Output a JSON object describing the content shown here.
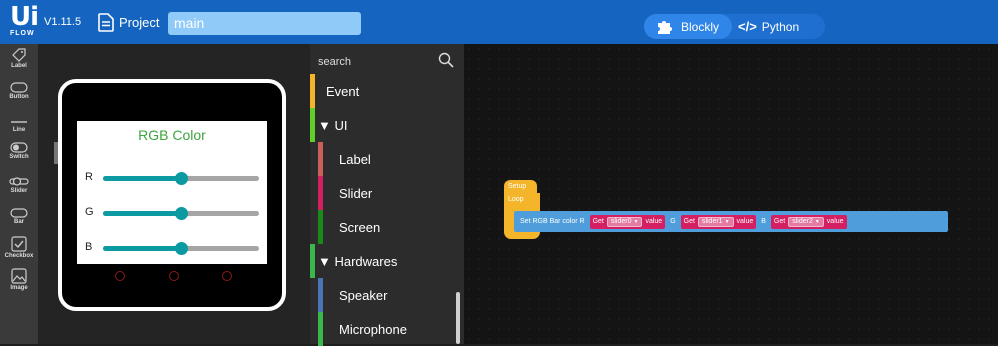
{
  "app": {
    "logo_main": "Ui",
    "logo_sub": "FLOW",
    "version": "V1.11.5",
    "project_label": "Project",
    "filename_value": "main"
  },
  "mode_toggle": {
    "blockly_label": "Blockly",
    "python_code_glyph": "</>",
    "python_label": "Python",
    "active": "Blockly"
  },
  "toolbox": {
    "items": [
      {
        "label": "Label",
        "icon": "tag-icon"
      },
      {
        "label": "Button",
        "icon": "button-icon"
      },
      {
        "label": "Line",
        "icon": "line-icon"
      },
      {
        "label": "Switch",
        "icon": "switch-icon"
      },
      {
        "label": "Slider",
        "icon": "slider-icon"
      },
      {
        "label": "Bar",
        "icon": "bar-icon"
      },
      {
        "label": "Checkbox",
        "icon": "checkbox-icon"
      },
      {
        "label": "Image",
        "icon": "image-icon"
      }
    ]
  },
  "device_screen": {
    "title": "RGB Color",
    "sliders": [
      {
        "label": "R",
        "value": 50
      },
      {
        "label": "G",
        "value": 50
      },
      {
        "label": "B",
        "value": 50
      }
    ],
    "colors": {
      "title": "#3ea43e",
      "slider": "#0b9aa2",
      "track": "#a5a5a5"
    }
  },
  "palette": {
    "search_placeholder": "search",
    "categories": [
      {
        "label": "Event",
        "color": "#f5b52a",
        "indent": false
      },
      {
        "label": "▼ UI",
        "color": "#5fcf2a",
        "indent": false
      },
      {
        "label": "Label",
        "color": "#c9605a",
        "indent": true
      },
      {
        "label": "Slider",
        "color": "#d41f63",
        "indent": true
      },
      {
        "label": "Screen",
        "color": "#188a18",
        "indent": true
      },
      {
        "label": "▼ Hardwares",
        "color": "#3cb84a",
        "indent": false
      },
      {
        "label": "Speaker",
        "color": "#4a74b8",
        "indent": true
      },
      {
        "label": "Microphone",
        "color": "#3cb84a",
        "indent": true
      }
    ]
  },
  "workspace": {
    "setup_label": "Setup",
    "loop_label": "Loop",
    "set_block": {
      "prefix": "Set RGB Bar color R",
      "get_label": "Get",
      "value_label": "value",
      "channels": [
        {
          "sep": "",
          "slider": "slider0"
        },
        {
          "sep": "G",
          "slider": "slider1"
        },
        {
          "sep": "B",
          "slider": "slider2"
        }
      ]
    },
    "colors": {
      "event": "#f5b52a",
      "set_block": "#4f9edb",
      "get_block": "#d41f63"
    }
  }
}
